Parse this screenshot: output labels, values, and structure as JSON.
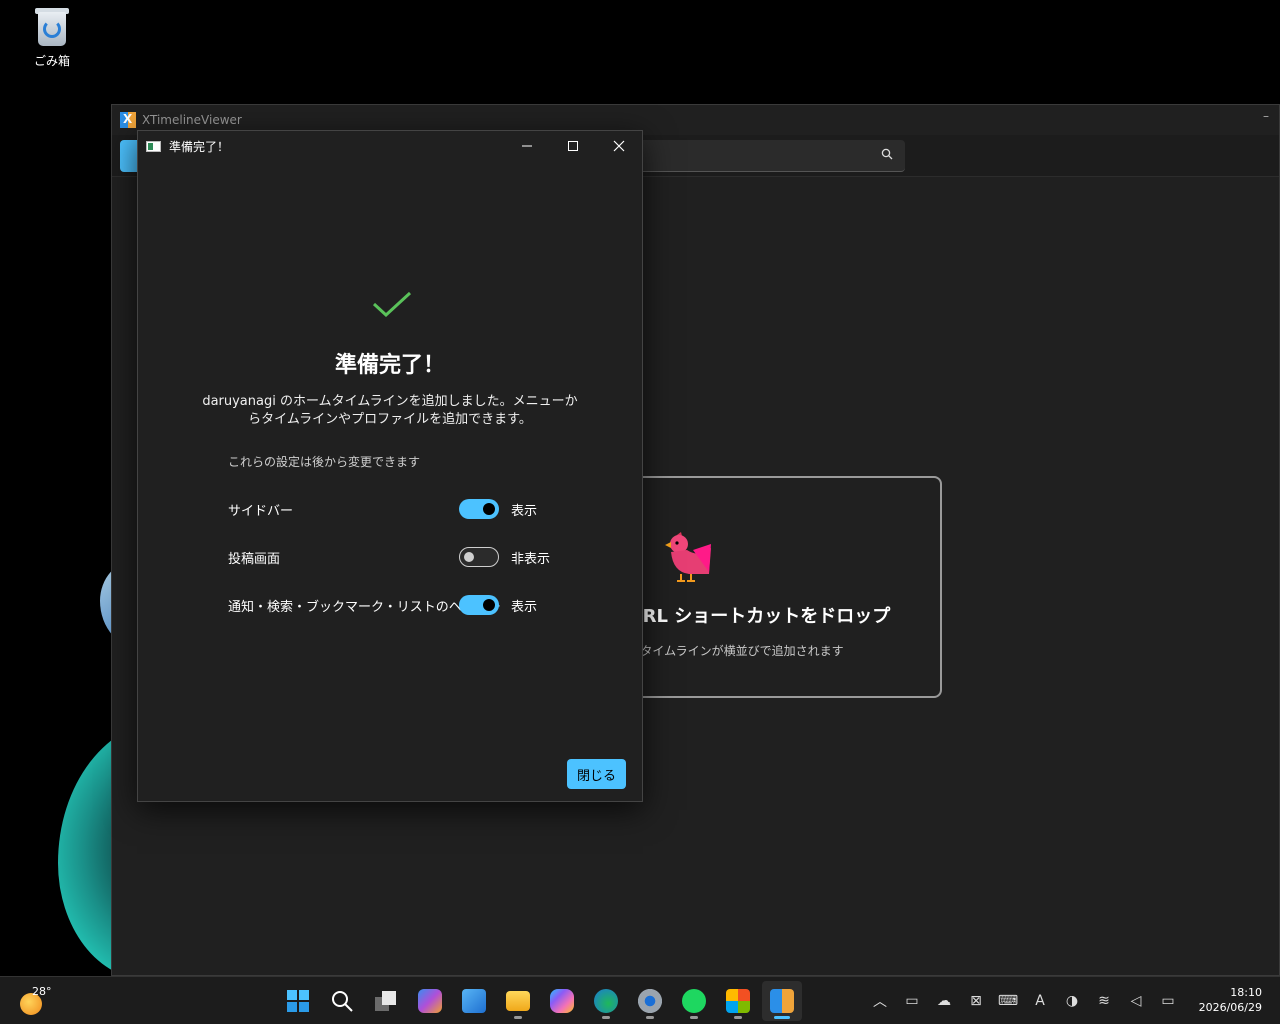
{
  "desktop": {
    "recycle_bin_label": "ごみ箱"
  },
  "app": {
    "title": "XTimelineViewer",
    "drop_title": "の URL ショートカットをドロップ",
    "drop_subtitle": "タイムラインが横並びで追加されます"
  },
  "dialog": {
    "title": "準備完了！",
    "heading": "準備完了！",
    "message": "daruyanagi のホームタイムラインを追加しました。メニューからタイムラインやプロファイルを追加できます。",
    "note": "これらの設定は後から変更できます",
    "settings": [
      {
        "label": "サイドバー",
        "enabled": true,
        "state": "表示"
      },
      {
        "label": "投稿画面",
        "enabled": false,
        "state": "非表示"
      },
      {
        "label": "通知・検索・ブックマーク・リストのヘッダー",
        "enabled": true,
        "state": "表示"
      }
    ],
    "close_label": "閉じる",
    "accent_color": "#4cc2ff"
  },
  "taskbar": {
    "weather_temp": "28°",
    "clock_time": "18:10",
    "clock_date": "2026/06/29",
    "apps": [
      "start-icon",
      "search-icon",
      "task-view-icon",
      "m365-icon",
      "paint-preview-icon",
      "file-explorer-icon",
      "copilot-icon",
      "edge-icon",
      "settings-icon",
      "spotify-icon",
      "store-icon",
      "xtimelineviewer-icon"
    ],
    "tray_ime": "A"
  }
}
